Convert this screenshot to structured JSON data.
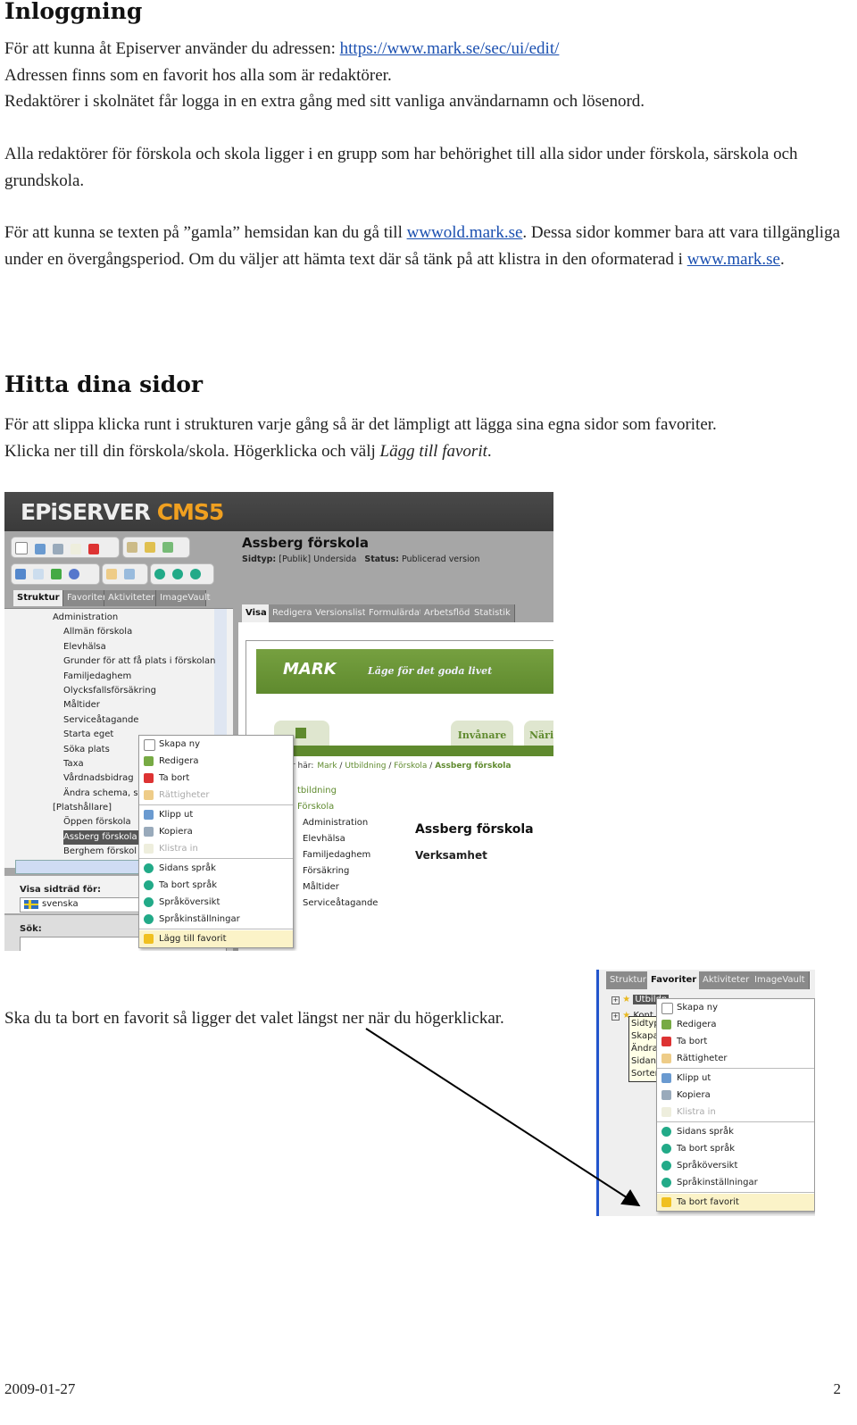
{
  "section1": {
    "title": "Inloggning",
    "p1_prefix": "För att kunna åt Episerver använder du adressen: ",
    "p1_link": "https://www.mark.se/sec/ui/edit/",
    "p1_line2": "Adressen finns som en favorit hos alla som är redaktörer.",
    "p1_line3": "Redaktörer i skolnätet får logga in en extra gång med sitt vanliga användarnamn och lösenord.",
    "p2": "Alla redaktörer för förskola och skola ligger i en grupp som har behörighet till alla sidor under förskola, särskola och grundskola.",
    "p3_a": "För att kunna se texten på ”gamla” hemsidan kan du gå till ",
    "p3_link1": "wwwold.mark.se",
    "p3_b": ". Dessa sidor kommer bara att vara tillgängliga under en övergångsperiod. Om du väljer att hämta text där så tänk på att klistra in den oformaterad i ",
    "p3_link2": "www.mark.se",
    "p3_c": "."
  },
  "section2": {
    "title": "Hitta dina sidor",
    "p1": "För att slippa klicka runt i strukturen varje gång så är det lämpligt att lägga sina egna sidor som favoriter.",
    "p2_a": "Klicka ner till din förskola/skola. Högerklicka och välj ",
    "p2_em": "Lägg till favorit",
    "p2_b": "."
  },
  "section3": {
    "p": "Ska du ta bort en favorit så ligger det valet längst ner när du högerklickar."
  },
  "screenshot1": {
    "logo_a": "EPiSERVER",
    "logo_b": " CMS5",
    "tabs": [
      "Struktur",
      "Favoriter",
      "Aktiviteter",
      "ImageVault"
    ],
    "tree": [
      "Administration",
      "Allmän förskola",
      "Elevhälsa",
      "Grunder för att få plats i förskolan",
      "Familjedaghem",
      "Olycksfallsförsäkring",
      "Måltider",
      "Serviceåtagande",
      "Starta eget",
      "Söka plats",
      "Taxa",
      "Vårdnadsbidrag",
      "Ändra schema, s",
      "[Platshållare]",
      "Öppen förskola",
      "Assberg förskola",
      "Berghem förskol"
    ],
    "lang_label": "Visa sidträd för:",
    "lang_value": "svenska",
    "search_label": "Sök:",
    "page_title": "Assberg förskola",
    "page_type_label": "Sidtyp:",
    "page_type": "[Publik] Undersida",
    "status_label": "Status:",
    "status": "Publicerad version",
    "page_tabs": [
      "Visa",
      "Redigera",
      "Versionslista",
      "Formulärdata",
      "Arbetsflöde",
      "Statistik"
    ],
    "banner_logo": "MARK",
    "banner_slogan": "Läge för det goda livet",
    "nav_tabs": [
      "Invånare",
      "Närin"
    ],
    "breadcrumb_prefix": "r här:",
    "breadcrumb": [
      "Mark",
      "Utbildning",
      "Förskola",
      "Assberg förskola"
    ],
    "subnav": [
      "tbildning",
      "Förskola",
      "Administration",
      "Elevhälsa",
      "Familjedaghem",
      "Försäkring",
      "Måltider",
      "Serviceåtagande"
    ],
    "content_title": "Assberg förskola",
    "content_sub": "Verksamhet",
    "menu": [
      [
        "Skapa ny",
        "Redigera",
        "Ta bort",
        "Rättigheter"
      ],
      [
        "Klipp ut",
        "Kopiera",
        "Klistra in"
      ],
      [
        "Sidans språk",
        "Ta bort språk",
        "Språköversikt",
        "Språkinställningar"
      ],
      [
        "Lägg till favorit"
      ]
    ],
    "menu_disabled": [
      "Rättigheter",
      "Klistra in"
    ]
  },
  "screenshot2": {
    "tabs": [
      "Struktur",
      "Favoriter",
      "Aktiviteter",
      "ImageVault"
    ],
    "tree": [
      "Utbildn",
      "Kont"
    ],
    "tooltip": [
      "Sidtyp",
      "Skapad",
      "Ändrad",
      "Sidans",
      "Sorteri"
    ],
    "menu": [
      [
        "Skapa ny",
        "Redigera",
        "Ta bort",
        "Rättigheter"
      ],
      [
        "Klipp ut",
        "Kopiera",
        "Klistra in"
      ],
      [
        "Sidans språk",
        "Ta bort språk",
        "Språköversikt",
        "Språkinställningar"
      ],
      [
        "Ta bort favorit"
      ]
    ]
  },
  "footer": {
    "date": "2009-01-27",
    "page": "2"
  },
  "colors": {
    "link": "#1a4fb0",
    "episerver_orange": "#f0a020",
    "mark_green": "#5f8a2e"
  }
}
